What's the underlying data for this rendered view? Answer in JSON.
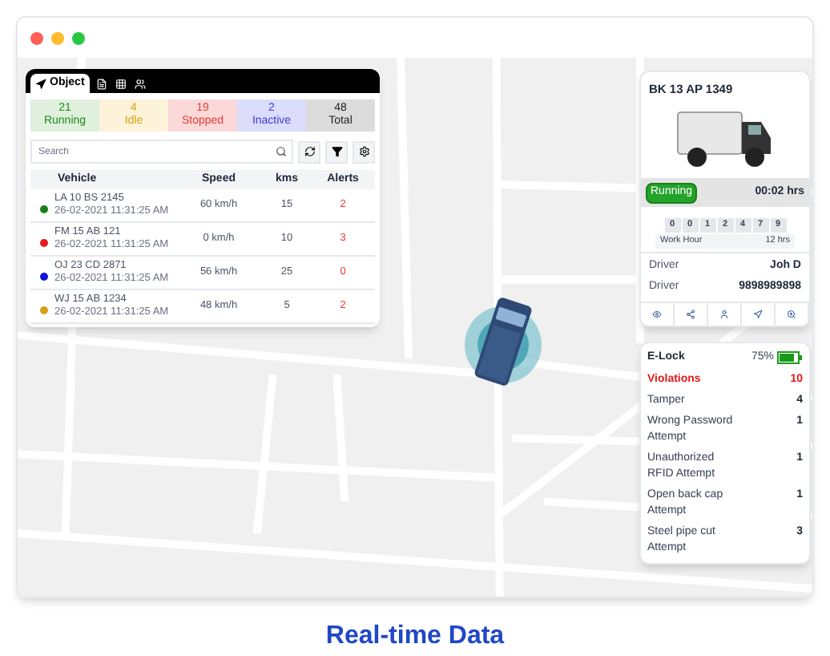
{
  "tabs": [
    {
      "kind": "text",
      "label": "Object",
      "selected": true
    },
    {
      "kind": "icon",
      "selected": false
    },
    {
      "kind": "icon",
      "selected": false
    },
    {
      "kind": "icon",
      "selected": false
    }
  ],
  "summary": [
    {
      "count": "21",
      "label": "Running",
      "color": "#1f8a1f"
    },
    {
      "count": "4",
      "label": "Idle",
      "color": "#d9a21b"
    },
    {
      "count": "19",
      "label": "Stopped",
      "color": "#e53935"
    },
    {
      "count": "2",
      "label": "Inactive",
      "color": "#3b3bd6"
    },
    {
      "count": "48",
      "label": "Total",
      "color": "#222222"
    }
  ],
  "search": {
    "placeholder": "Search"
  },
  "table": {
    "columns": [
      "Vehicle",
      "Speed",
      "kms",
      "Alerts"
    ],
    "rows": [
      {
        "vehicle": "LA 10 BS 2145",
        "time": "26-02-2021 11:31:25 AM",
        "speed": "60 km/h",
        "kms": "15",
        "alerts": "2",
        "color": "#1a7f1a"
      },
      {
        "vehicle": "FM 15 AB 121",
        "time": "26-02-2021 11:31:25 AM",
        "speed": "0 km/h",
        "kms": "10",
        "alerts": "3",
        "color": "#e81c1c"
      },
      {
        "vehicle": "OJ 23 CD 2871",
        "time": "26-02-2021 11:31:25 AM",
        "speed": "56 km/h",
        "kms": "25",
        "alerts": "0",
        "color": "#1414d6"
      },
      {
        "vehicle": "WJ 15 AB 1234",
        "time": "26-02-2021 11:31:25 AM",
        "speed": "48 km/h",
        "kms": "5",
        "alerts": "2",
        "color": "#d4a017"
      }
    ]
  },
  "vehicle_card": {
    "plate": "BK 13 AP 1349",
    "status": "Running",
    "duration": "00:02 hrs",
    "odometer": [
      "0",
      "0",
      "1",
      "2",
      "4",
      "7",
      "9"
    ],
    "work_hour": {
      "label": "Work Hour",
      "value": "12 hrs"
    },
    "details": [
      {
        "label": "Driver",
        "value": "Joh D"
      },
      {
        "label": "Driver",
        "value": "9898989898"
      }
    ]
  },
  "elock": {
    "title": "E-Lock",
    "battery": "75%",
    "violations": {
      "label": "Violations",
      "count": "10"
    },
    "items": [
      {
        "label": "Tamper",
        "count": "4"
      },
      {
        "label": "Wrong Password Attempt",
        "count": "1"
      },
      {
        "label": "Unauthorized RFID Attempt",
        "count": "1"
      },
      {
        "label": "Open back cap Attempt",
        "count": "1"
      },
      {
        "label": "Steel pipe cut Attempt",
        "count": "3"
      }
    ]
  },
  "caption": "Real-time Data"
}
